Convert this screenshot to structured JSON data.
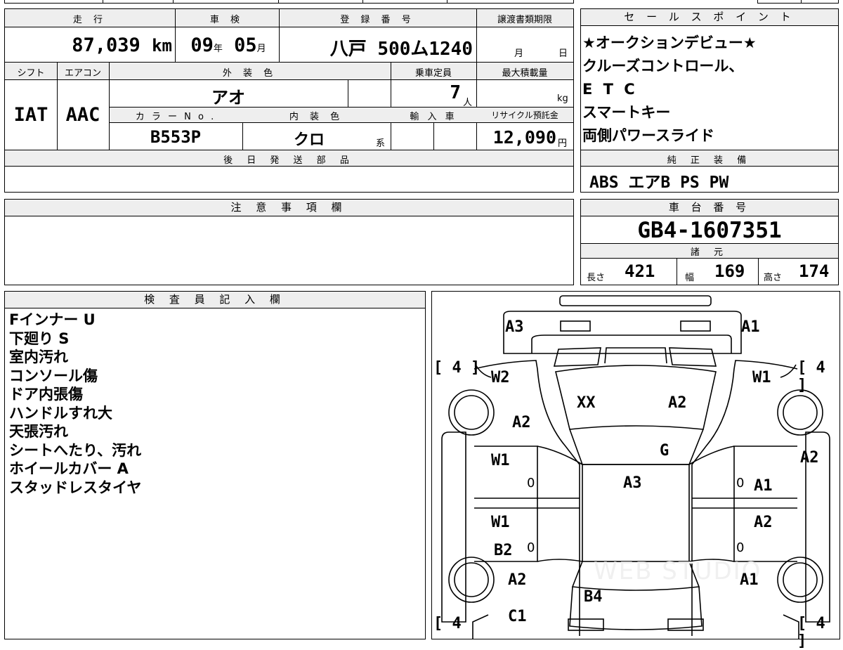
{
  "top_sheet": {
    "headers": {
      "mileage": "走 行",
      "inspection": "車 検",
      "registration": "登 録 番 号",
      "transfer_deadline": "譲渡書類期限",
      "shift": "シフト",
      "aircon": "エアコン",
      "exterior_color": "外 装 色",
      "capacity": "乗車定員",
      "max_load": "最大積載量",
      "color_no": "カ ラ ー N o .",
      "interior_color": "内 装 色",
      "import": "輸 入 車",
      "recycle_fee": "リサイクル預託金",
      "later_parts": "後 日 発 送 部 品"
    },
    "mileage": "87,039",
    "mileage_unit": "km",
    "inspection_year": "09",
    "year_unit": "年",
    "inspection_month": "05",
    "month_unit": "月",
    "plate": "八戸 500ム1240",
    "deadline_month_unit": "月",
    "deadline_day_unit": "日",
    "shift": "IAT",
    "aircon": "AAC",
    "exterior_color": "アオ",
    "capacity": "7",
    "capacity_unit": "人",
    "load_unit": "kg",
    "color_no": "B553P",
    "interior_color": "クロ",
    "interior_suffix": "系",
    "recycle_fee": "12,090",
    "yen": "円"
  },
  "sales_points": {
    "title": "セ ー ル ス ポ イ ン ト",
    "lines": [
      "★オークションデビュー★",
      "クルーズコントロール、",
      "E T C",
      "スマートキー",
      "両側パワースライド"
    ]
  },
  "genuine_equipment": {
    "title": "純 正 装 備",
    "value": "ABS エアB PS PW"
  },
  "caution": {
    "title": "注 意 事 項 欄"
  },
  "chassis": {
    "title": "車 台 番 号",
    "value": "GB4-1607351",
    "specs_title": "諸 元",
    "length_label": "長さ",
    "length": "421",
    "width_label": "幅",
    "width": "169",
    "height_label": "高さ",
    "height": "174"
  },
  "inspector": {
    "title": "検 査 員 記 入 欄",
    "notes": [
      "Fインナー U",
      "下廻り S",
      "室内汚れ",
      "コンソール傷",
      "ドア内張傷",
      "ハンドルすれ大",
      "天張汚れ",
      "シートへたり、汚れ",
      "ホイールカバー A",
      "スタッドレスタイヤ"
    ]
  },
  "diagram": {
    "watermark": "WEB STUDIO",
    "tread_left_front": "[ 4 ]",
    "tread_right_front": "[ 4 ]",
    "tread_left_rear": "[ 4",
    "tread_right_rear": "[ 4 ]",
    "marks": {
      "a3_front_left": "A3",
      "a1_front_right": "A1",
      "w2": "W2",
      "w1_front_right": "W1",
      "xx": "XX",
      "a2_windshield": "A2",
      "a2_left_fender": "A2",
      "g": "G",
      "w1_left_front_door": "W1",
      "a3_roof": "A3",
      "a2_right_edge": "A2",
      "a1_right_front_door": "A1",
      "w1_left_rear_door": "W1",
      "a2_right_rear_door": "A2",
      "b2": "B2",
      "a2_left_quarter": "A2",
      "a1_right_quarter": "A1",
      "b4": "B4",
      "c1": "C1",
      "zero_1": "0",
      "zero_2": "0",
      "zero_3": "0",
      "zero_4": "0"
    }
  }
}
